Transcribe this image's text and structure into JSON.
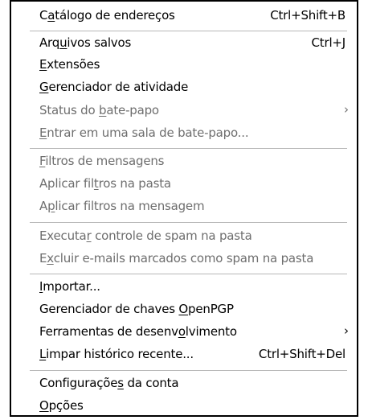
{
  "menu": {
    "address_book": {
      "pre": "C",
      "key": "a",
      "post": "tálogo de endereços",
      "shortcut": "Ctrl+Shift+B"
    },
    "saved_files": {
      "pre": "Arq",
      "key": "u",
      "post": "ivos salvos",
      "shortcut": "Ctrl+J"
    },
    "extensions": {
      "pre": "",
      "key": "E",
      "post": "xtensões"
    },
    "activity_manager": {
      "pre": "",
      "key": "G",
      "post": "erenciador de atividade"
    },
    "chat_status": {
      "pre": "Status do ",
      "key": "b",
      "post": "ate-papo",
      "arrow": "›"
    },
    "join_chat": {
      "pre": "",
      "key": "E",
      "post": "ntrar em uma sala de bate-papo..."
    },
    "message_filters": {
      "pre": "",
      "key": "F",
      "post": "iltros de mensagens"
    },
    "apply_filters_folder": {
      "pre": "Aplicar fil",
      "key": "t",
      "post": "ros na pasta"
    },
    "apply_filters_message": {
      "pre": "A",
      "key": "p",
      "post": "licar filtros na mensagem"
    },
    "run_spam_controls": {
      "pre": "Executa",
      "key": "r",
      "post": " controle de spam na pasta"
    },
    "delete_spam": {
      "pre": "E",
      "key": "x",
      "post": "cluir e-mails marcados como spam na pasta"
    },
    "import": {
      "pre": "",
      "key": "I",
      "post": "mportar..."
    },
    "openpgp_manager": {
      "pre": "Gerenciador de chaves ",
      "key": "O",
      "post": "penPGP"
    },
    "dev_tools": {
      "pre": "Ferramentas de desenv",
      "key": "o",
      "post": "lvimento",
      "arrow": "›"
    },
    "clear_history": {
      "pre": "",
      "key": "L",
      "post": "impar histórico recente...",
      "shortcut": "Ctrl+Shift+Del"
    },
    "account_settings": {
      "pre": "Configuraçõe",
      "key": "s",
      "post": " da conta"
    },
    "options": {
      "pre": "",
      "key": "O",
      "post": "pções"
    }
  }
}
